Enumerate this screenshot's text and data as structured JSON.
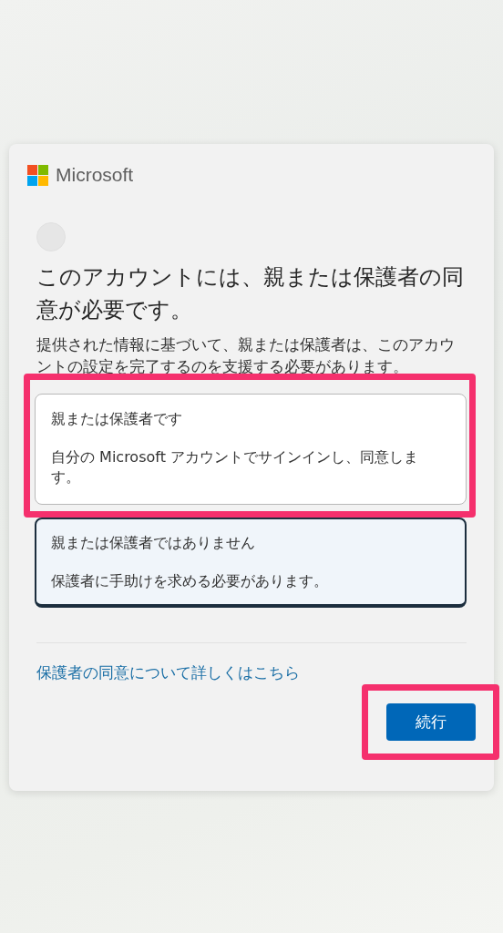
{
  "brand": "Microsoft",
  "title": "このアカウントには、親または保護者の同意が必要です。",
  "description": "提供された情報に基づいて、親または保護者は、このアカウントの設定を完了するのを支援する必要があります。",
  "options": [
    {
      "title": "親または保護者です",
      "description": "自分の Microsoft アカウントでサインインし、同意します。",
      "selected": false,
      "highlighted": true
    },
    {
      "title": "親または保護者ではありません",
      "description": "保護者に手助けを求める必要があります。",
      "selected": true,
      "highlighted": false
    }
  ],
  "link": "保護者の同意について詳しくはこちら",
  "continue_button": {
    "label": "続行",
    "highlighted": true
  }
}
